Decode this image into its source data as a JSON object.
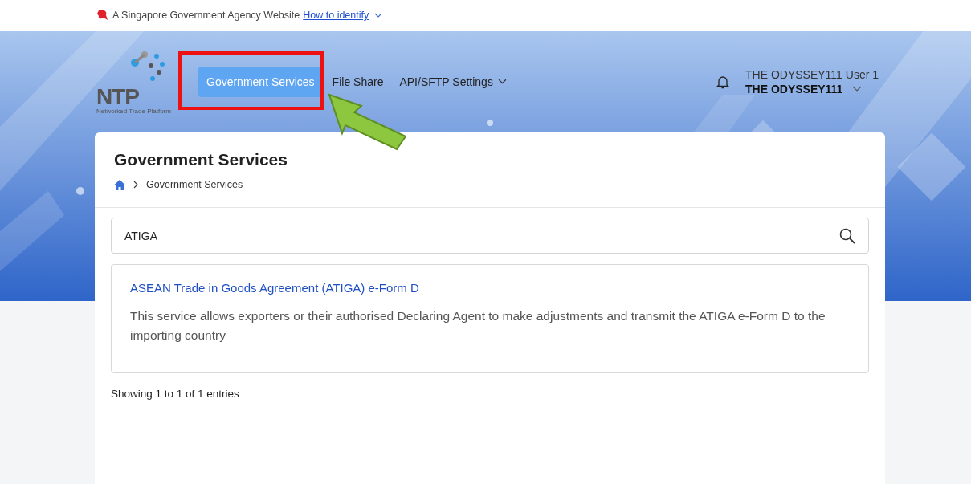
{
  "masthead": {
    "text": "A Singapore Government Agency Website",
    "link": "How to identify"
  },
  "logo": {
    "letters": "NTP",
    "tagline": "Networked Trade Platform"
  },
  "nav": [
    {
      "label": "Government Services",
      "selected": true,
      "has_menu": false
    },
    {
      "label": "File Share",
      "selected": false,
      "has_menu": false
    },
    {
      "label": "API/SFTP Settings",
      "selected": false,
      "has_menu": true
    }
  ],
  "user": {
    "name": "THE ODYSSEY111 User 1",
    "org": "THE ODYSSEY111"
  },
  "page": {
    "title": "Government Services",
    "breadcrumb": [
      "Government Services"
    ]
  },
  "search": {
    "value": "ATIGA"
  },
  "results": [
    {
      "title": "ASEAN Trade in Goods Agreement (ATIGA) e-Form D",
      "description": "This service allows exporters or their authorised Declaring Agent to make adjustments and transmit the ATIGA e-Form D to the importing country"
    }
  ],
  "footer_count": "Showing 1 to 1 of 1 entries"
}
